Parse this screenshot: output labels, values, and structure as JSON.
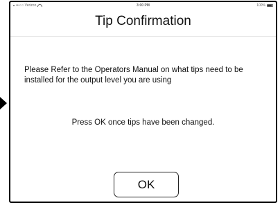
{
  "status_bar": {
    "carrier": "•••○○ Verizon",
    "time": "3:00 PM",
    "battery": "100%"
  },
  "dialog": {
    "title": "Tip Confirmation",
    "message": "Please Refer to the Operators Manual on what tips need to be installed for the output level you are using",
    "instruction": "Press OK once tips have been changed.",
    "ok_label": "OK"
  }
}
